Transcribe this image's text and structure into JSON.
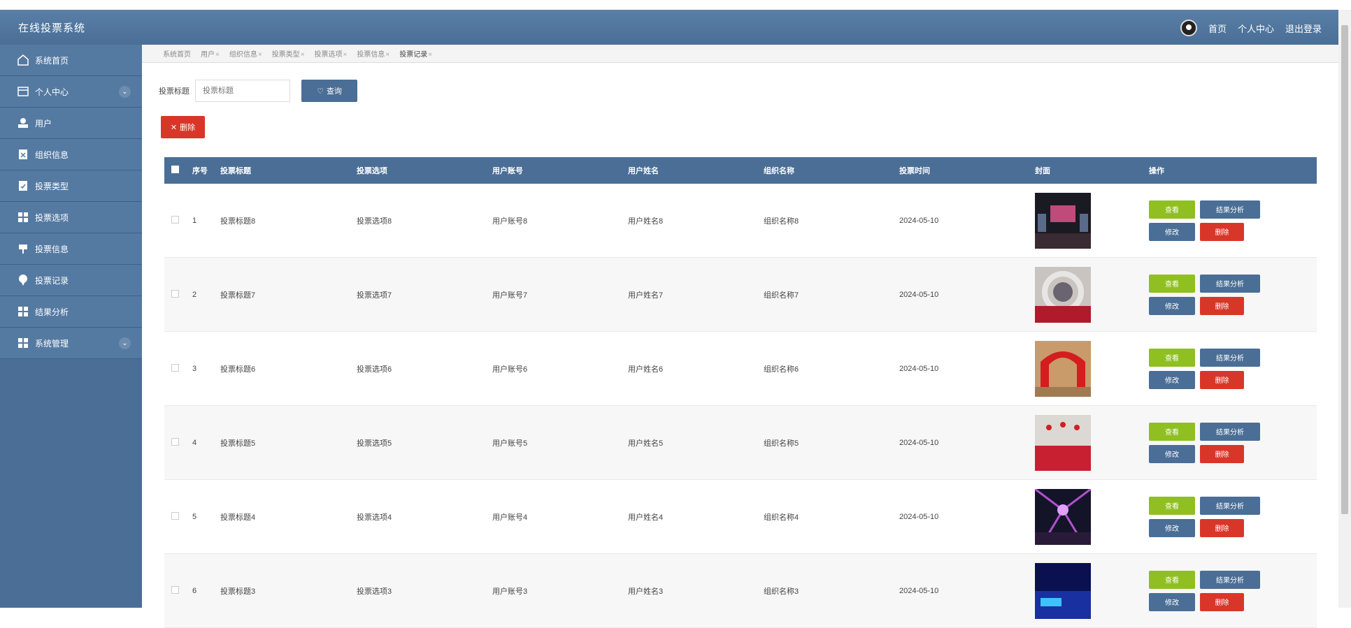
{
  "app": {
    "title": "在线投票系统"
  },
  "header": {
    "home_link": "首页",
    "profile_link": "个人中心",
    "logout_link": "退出登录"
  },
  "sidebar": {
    "items": [
      {
        "label": "系统首页",
        "icon": "home-icon"
      },
      {
        "label": "个人中心",
        "icon": "card-icon",
        "expandable": true
      },
      {
        "label": "用户",
        "icon": "user-icon"
      },
      {
        "label": "组织信息",
        "icon": "clipboard-icon"
      },
      {
        "label": "投票类型",
        "icon": "check-clipboard-icon"
      },
      {
        "label": "投票选项",
        "icon": "grid-icon"
      },
      {
        "label": "投票信息",
        "icon": "flag-icon"
      },
      {
        "label": "投票记录",
        "icon": "pin-icon"
      },
      {
        "label": "结果分析",
        "icon": "grid-icon"
      },
      {
        "label": "系统管理",
        "icon": "grid-icon",
        "expandable": true
      }
    ]
  },
  "tabs": [
    {
      "label": "系统首页",
      "closable": false
    },
    {
      "label": "用户",
      "closable": true
    },
    {
      "label": "组织信息",
      "closable": true
    },
    {
      "label": "投票类型",
      "closable": true
    },
    {
      "label": "投票选项",
      "closable": true
    },
    {
      "label": "投票信息",
      "closable": true
    },
    {
      "label": "投票记录",
      "closable": true,
      "active": true
    }
  ],
  "search": {
    "label": "投票标题",
    "placeholder": "投票标题",
    "button_label": "查询"
  },
  "toolbar": {
    "delete_label": "删除"
  },
  "table": {
    "headers": [
      "序号",
      "投票标题",
      "投票选项",
      "用户账号",
      "用户姓名",
      "组织名称",
      "投票时间",
      "封面",
      "操作"
    ],
    "rows": [
      {
        "idx": "1",
        "title": "投票标题8",
        "option": "投票选项8",
        "account": "用户账号8",
        "name": "用户姓名8",
        "org": "组织名称8",
        "time": "2024-05-10"
      },
      {
        "idx": "2",
        "title": "投票标题7",
        "option": "投票选项7",
        "account": "用户账号7",
        "name": "用户姓名7",
        "org": "组织名称7",
        "time": "2024-05-10"
      },
      {
        "idx": "3",
        "title": "投票标题6",
        "option": "投票选项6",
        "account": "用户账号6",
        "name": "用户姓名6",
        "org": "组织名称6",
        "time": "2024-05-10"
      },
      {
        "idx": "4",
        "title": "投票标题5",
        "option": "投票选项5",
        "account": "用户账号5",
        "name": "用户姓名5",
        "org": "组织名称5",
        "time": "2024-05-10"
      },
      {
        "idx": "5",
        "title": "投票标题4",
        "option": "投票选项4",
        "account": "用户账号4",
        "name": "用户姓名4",
        "org": "组织名称4",
        "time": "2024-05-10"
      },
      {
        "idx": "6",
        "title": "投票标题3",
        "option": "投票选项3",
        "account": "用户账号3",
        "name": "用户姓名3",
        "org": "组织名称3",
        "time": "2024-05-10"
      }
    ],
    "row_actions": {
      "view": "查看",
      "analyze": "结果分析",
      "edit": "修改",
      "delete": "删除"
    }
  },
  "colors": {
    "primary": "#4a6e96",
    "success": "#8fbf21",
    "danger": "#d9362a"
  }
}
